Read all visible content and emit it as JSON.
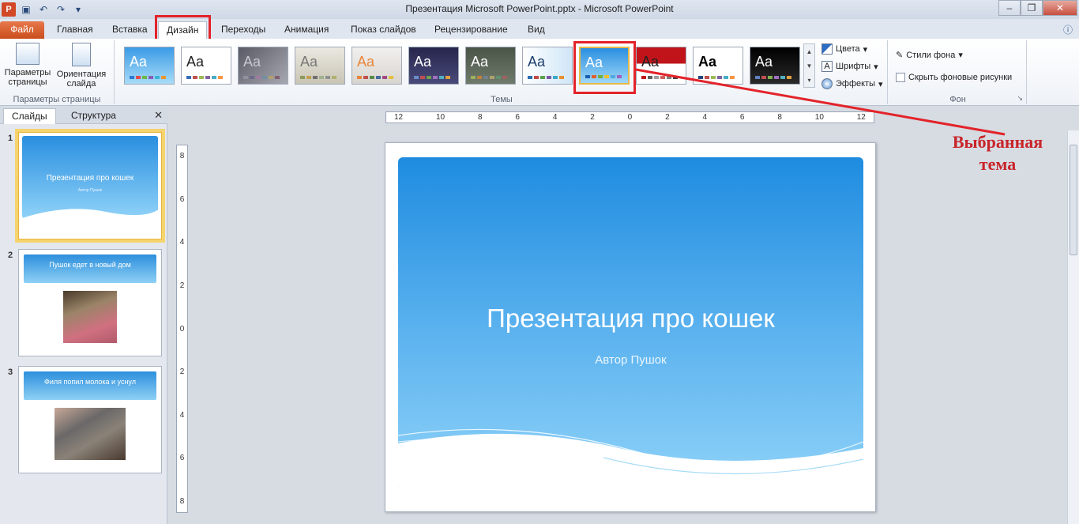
{
  "window": {
    "title": "Презентация Microsoft PowerPoint.pptx  -  Microsoft PowerPoint",
    "app_icon": "P",
    "controls": [
      "–",
      "❐",
      "✕"
    ]
  },
  "ribbon_tabs": [
    {
      "label": "Файл"
    },
    {
      "label": "Главная"
    },
    {
      "label": "Вставка"
    },
    {
      "label": "Дизайн"
    },
    {
      "label": "Переходы"
    },
    {
      "label": "Анимация"
    },
    {
      "label": "Показ слайдов"
    },
    {
      "label": "Рецензирование"
    },
    {
      "label": "Вид"
    }
  ],
  "active_tab": "Дизайн",
  "page_setup_group": {
    "label": "Параметры страницы",
    "page_setup_button": "Параметры страницы",
    "orientation_button": "Ориентация слайда"
  },
  "themes_group": {
    "label": "Темы",
    "theme_sample": "Aa",
    "selected_index": 8,
    "theme_count": 12
  },
  "theme_options": {
    "colors": "Цвета",
    "fonts": "Шрифты",
    "effects": "Эффекты"
  },
  "background_group": {
    "label": "Фон",
    "background_styles": "Стили фона",
    "hide_background": "Скрыть фоновые рисунки"
  },
  "left_panel": {
    "tabs": [
      "Слайды",
      "Структура"
    ],
    "close": "✕",
    "slides": [
      {
        "num": "1",
        "title": "Презентация про кошек",
        "subtitle": "Автор Пушок"
      },
      {
        "num": "2",
        "title": "Пушок едет в новый дом"
      },
      {
        "num": "3",
        "title": "Филя попил молока и уснул"
      }
    ]
  },
  "rulers": {
    "horizontal": [
      "12",
      "10",
      "8",
      "6",
      "4",
      "2",
      "0",
      "2",
      "4",
      "6",
      "8",
      "10",
      "12"
    ],
    "vertical": [
      "8",
      "6",
      "4",
      "2",
      "0",
      "2",
      "4",
      "6",
      "8"
    ]
  },
  "slide": {
    "title": "Презентация про кошек",
    "subtitle": "Автор  Пушок"
  },
  "annotation": {
    "line1": "Выбранная",
    "line2": "тема",
    "color": "#c8252a"
  }
}
